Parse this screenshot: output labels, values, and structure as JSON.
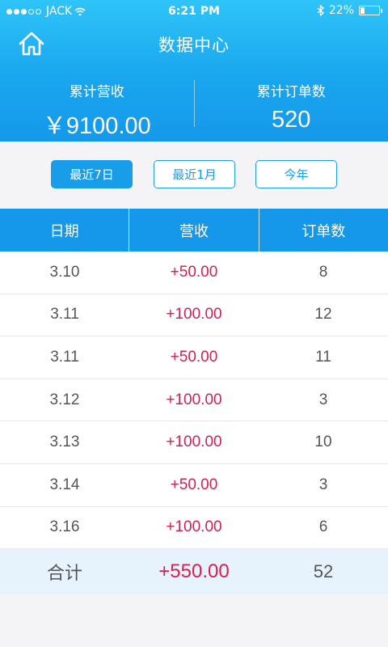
{
  "status_bar": {
    "carrier": "JACK",
    "time": "6:21 PM",
    "battery": "22%",
    "battery_level": 0.22
  },
  "header": {
    "title": "数据中心",
    "home_icon": "home-icon"
  },
  "stats": {
    "revenue_label": "累计营收",
    "revenue_value": "￥9100.00",
    "orders_label": "累计订单数",
    "orders_value": "520"
  },
  "filters": [
    {
      "label": "最近7日",
      "active": true
    },
    {
      "label": "最近1月",
      "active": false
    },
    {
      "label": "今年",
      "active": false
    }
  ],
  "table": {
    "headers": [
      "日期",
      "营收",
      "订单数"
    ],
    "rows": [
      {
        "date": "3.10",
        "revenue": "+50.00",
        "orders": "8"
      },
      {
        "date": "3.11",
        "revenue": "+100.00",
        "orders": "12"
      },
      {
        "date": "3.11",
        "revenue": "+50.00",
        "orders": "11"
      },
      {
        "date": "3.12",
        "revenue": "+100.00",
        "orders": "3"
      },
      {
        "date": "3.13",
        "revenue": "+100.00",
        "orders": "10"
      },
      {
        "date": "3.14",
        "revenue": "+50.00",
        "orders": "3"
      },
      {
        "date": "3.16",
        "revenue": "+100.00",
        "orders": "6"
      }
    ],
    "total": {
      "label": "合计",
      "revenue": "+550.00",
      "orders": "52"
    }
  },
  "colors": {
    "accent": "#1a9de8",
    "revenue": "#d6204e"
  }
}
